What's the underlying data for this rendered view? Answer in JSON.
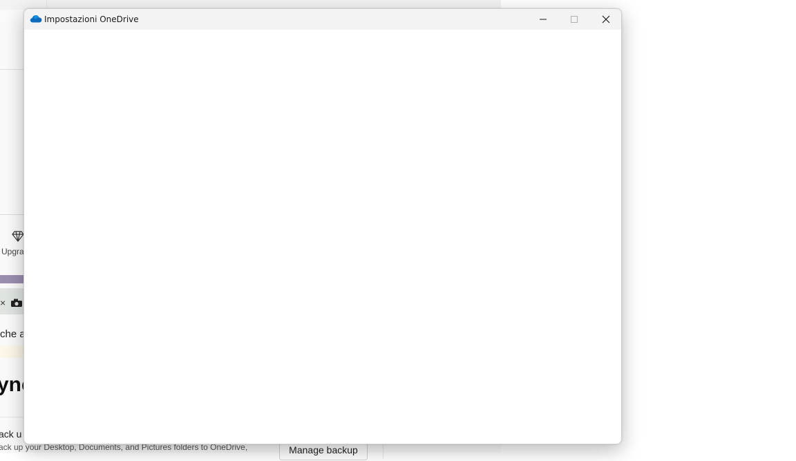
{
  "background": {
    "upgrade_label": "Upgra",
    "upgrade_icon": "diamond-icon",
    "notice_text": "che ap",
    "sync_title": "ync",
    "backup_title": "ack u",
    "backup_description": "ack up your Desktop, Documents, and Pictures folders to OneDrive,",
    "manage_backup_label": "Manage backup"
  },
  "dialog": {
    "title": "Impostazioni OneDrive",
    "app_icon": "onedrive-cloud-icon",
    "accent_color": "#0f6cbd",
    "controls": {
      "minimize": "minimize-icon",
      "maximize": "maximize-icon",
      "close": "close-icon"
    }
  }
}
